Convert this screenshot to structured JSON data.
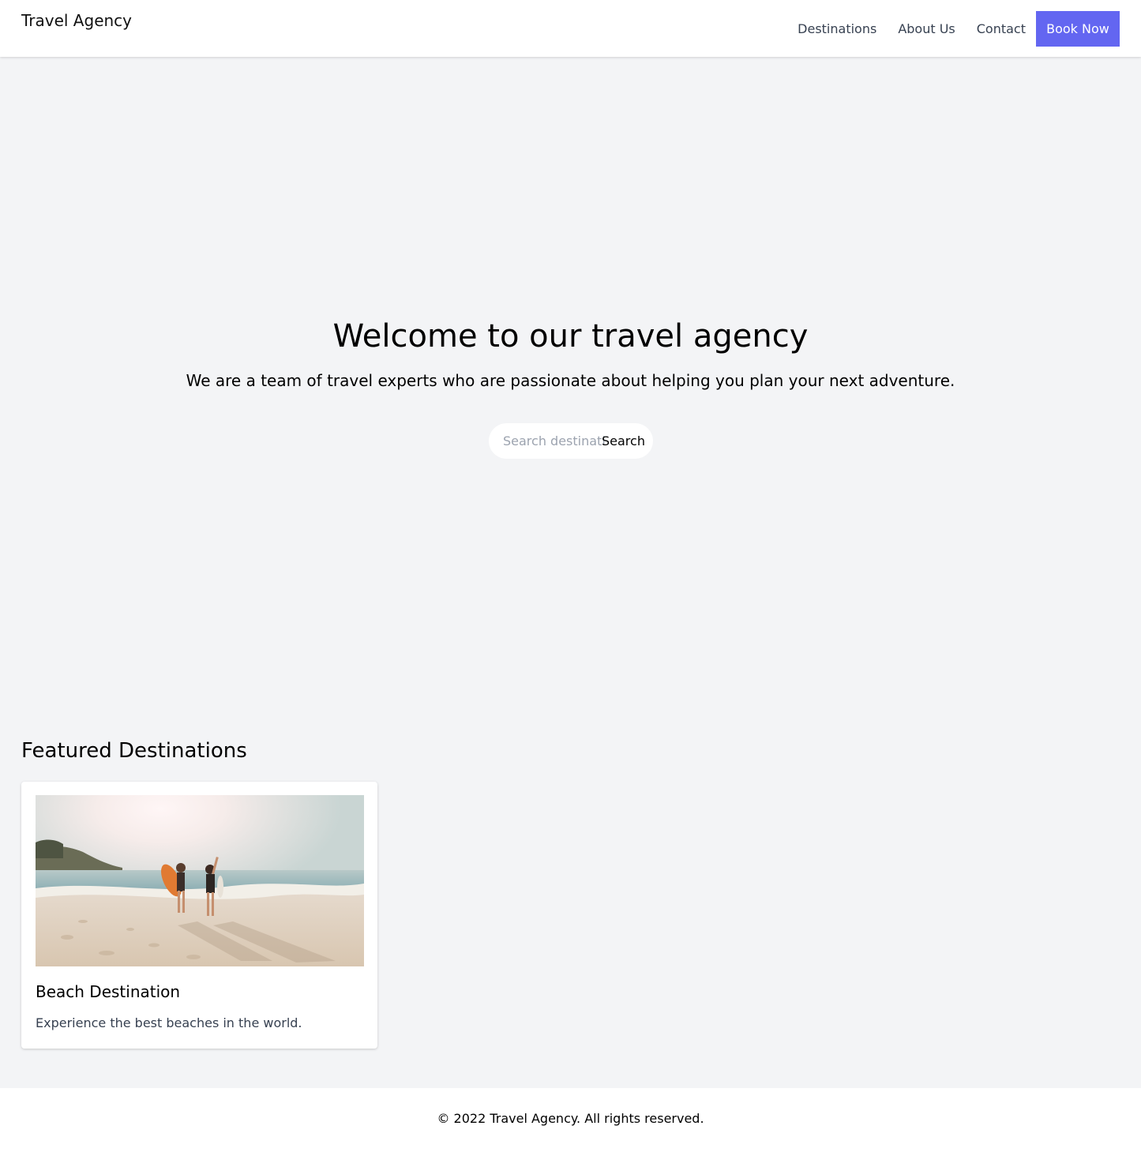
{
  "header": {
    "brand": "Travel Agency",
    "nav": [
      {
        "label": "Destinations"
      },
      {
        "label": "About Us"
      },
      {
        "label": "Contact"
      }
    ],
    "cta_label": "Book Now",
    "cta_color": "#6366f1"
  },
  "hero": {
    "title": "Welcome to our travel agency",
    "subtitle": "We are a team of travel experts who are passionate about helping you plan your next adventure.",
    "search": {
      "placeholder": "Search destinations",
      "button_label": "Search"
    }
  },
  "featured": {
    "title": "Featured Destinations",
    "cards": [
      {
        "title": "Beach Destination",
        "description": "Experience the best beaches in the world."
      }
    ]
  },
  "footer": {
    "text": "© 2022 Travel Agency. All rights reserved."
  }
}
